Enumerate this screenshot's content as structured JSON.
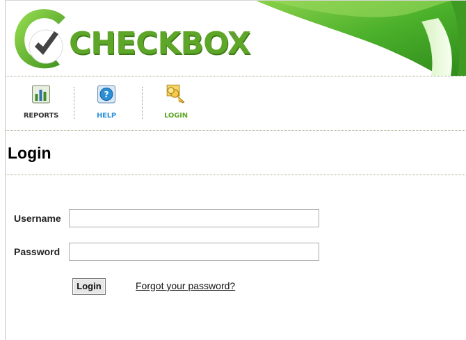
{
  "app": {
    "logo_text": "CHECKBOX",
    "logo_reg": "®"
  },
  "toolbar": {
    "items": [
      {
        "label": "REPORTS",
        "icon": "reports-chart-icon",
        "color": "#333333"
      },
      {
        "label": "HELP",
        "icon": "help-question-icon",
        "color": "#2a8fd6"
      },
      {
        "label": "LOGIN",
        "icon": "login-keys-icon",
        "color": "#5ea628"
      }
    ]
  },
  "page": {
    "title": "Login"
  },
  "form": {
    "username_label": "Username",
    "username_value": "",
    "password_label": "Password",
    "password_value": "",
    "login_button": "Login",
    "forgot_link": "Forgot your password?"
  },
  "colors": {
    "brand_green": "#5ea628",
    "help_blue": "#2a8fd6"
  }
}
